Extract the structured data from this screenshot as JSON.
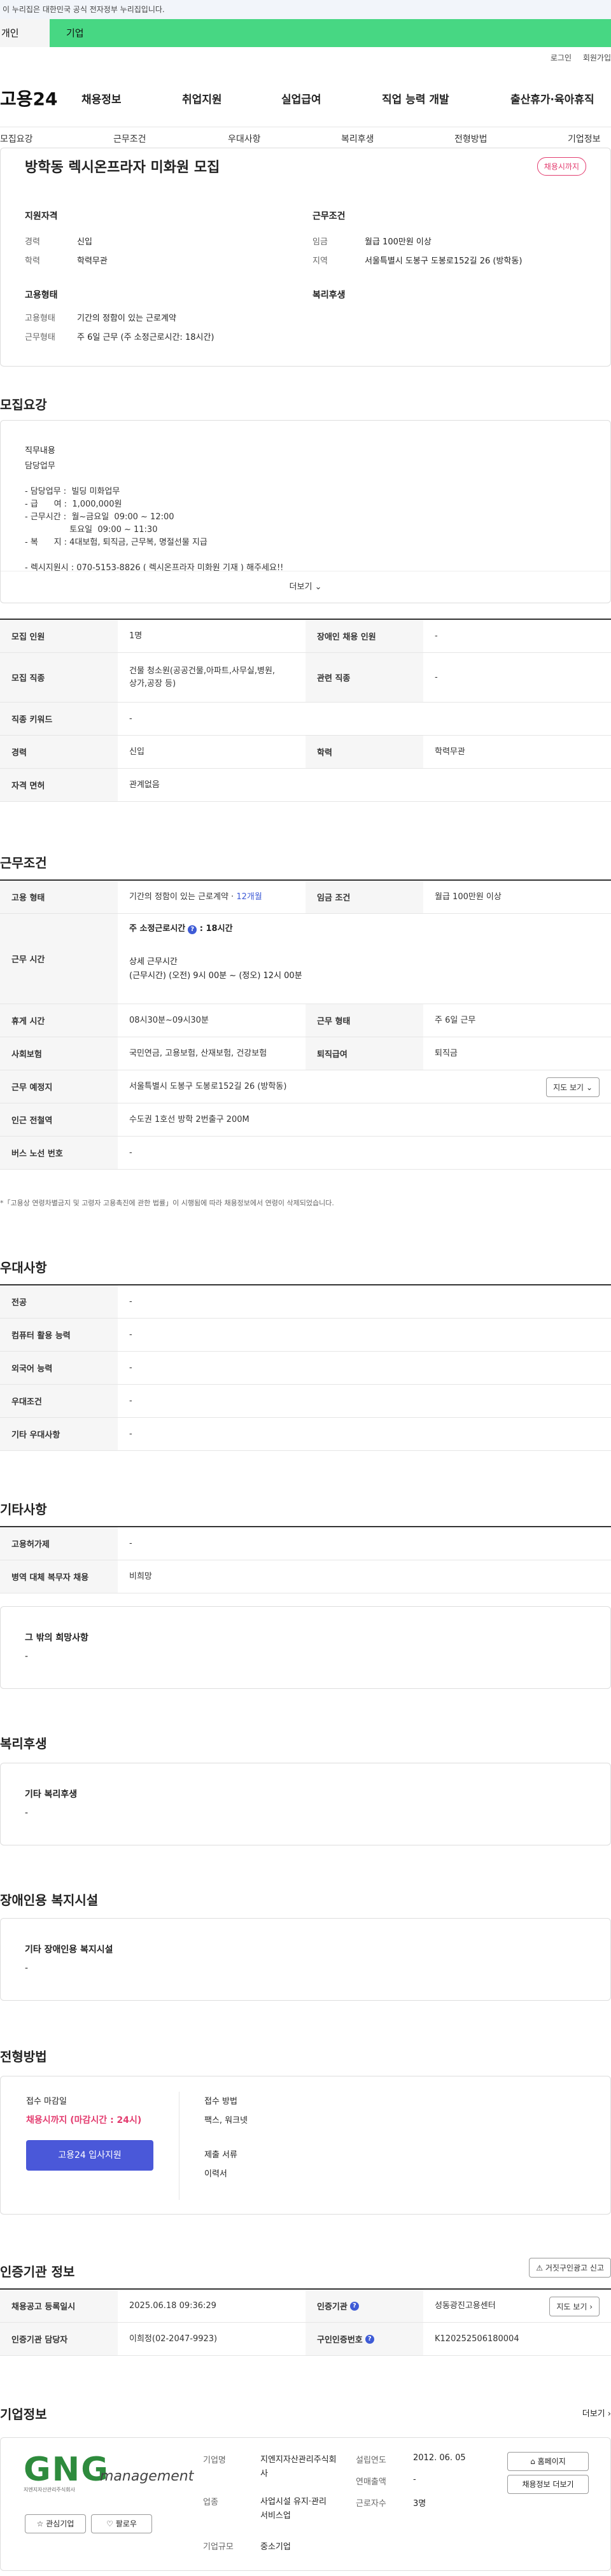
{
  "header": {
    "gov_notice": "이 누리집은 대한민국 공식 전자정부 누리집입니다.",
    "tab_individual": "개인",
    "tab_enterprise": "기업",
    "login": "로그인",
    "join": "회원가입",
    "logo": "고용24",
    "gnb": [
      "채용정보",
      "취업지원",
      "실업급여",
      "직업 능력 개발",
      "출산휴가·육아휴직"
    ]
  },
  "subnav": [
    "모집요강",
    "근무조건",
    "우대사항",
    "복리후생",
    "전형방법",
    "기업정보"
  ],
  "summary": {
    "title": "방학동 렉시온프라자 미화원 모집",
    "badge": "채용시까지",
    "qual_heading": "지원자격",
    "exp_label": "경력",
    "exp_value": "신입",
    "edu_label": "학력",
    "edu_value": "학력무관",
    "work_heading": "근무조건",
    "wage_label": "임금",
    "wage_value": "월급 100만원 이상",
    "region_label": "지역",
    "region_value": "서울특별시 도봉구 도봉로152길 26 (방학동)",
    "emp_heading": "고용형태",
    "emptype_label": "고용형태",
    "emptype_value": "기간의 정함이 있는 근로계약",
    "worktype_label": "근무형태",
    "worktype_value": "주 6일 근무 (주 소정근로시간: 18시간)",
    "welfare_heading": "복리후생"
  },
  "recruit": {
    "heading": "모집요강",
    "detail_title": "직무내용",
    "detail_text": "담당업무\n\n- 담당업무 :  빌딩 미화업무\n- 급      여 :  1,000,000원\n- 근무시간 :  월~금요일  09:00 ~ 12:00\n                 토요일  09:00 ~ 11:30\n- 복      지 : 4대보험, 퇴직금, 근무복, 명절선물 지급\n\n- 렉시지원시 : 070-5153-8826 ( 렉시온프라자 미화원 기재 ) 해주세요!!",
    "more": "더보기"
  },
  "recruit_table": {
    "headcount_label": "모집 인원",
    "headcount_value": "1명",
    "disabled_label": "장애인 채용 인원",
    "disabled_value": "-",
    "job_label": "모집 직종",
    "job_value": "건물 청소원(공공건물,아파트,사무실,병원,\n상가,공장 등)",
    "related_label": "관련 직종",
    "related_value": "-",
    "keyword_label": "직종 키워드",
    "keyword_value": "-",
    "exp_label": "경력",
    "exp_value": "신입",
    "edu_label": "학력",
    "edu_value": "학력무관",
    "license_label": "자격 면허",
    "license_value": "관계없음"
  },
  "conditions": {
    "heading": "근무조건",
    "emp_label": "고용 형태",
    "emp_value": "기간의 정함이 있는 근로계약",
    "emp_months": "12개월",
    "wage_label": "임금 조건",
    "wage_value": "월급 100만원 이상",
    "hours_label": "근무 시간",
    "hours_week": "주 소정근로시간",
    "hours_week_value": "18시간",
    "hours_detail_title": "상세 근무시간",
    "hours_detail": "(근무시간) (오전) 9시 00분 ~ (정오) 12시 00분",
    "break_label": "휴게 시간",
    "break_value": "08시30분~09시30분",
    "form_label": "근무 형태",
    "form_value": "주 6일 근무",
    "insurance_label": "사회보험",
    "insurance_value": "국민연금, 고용보험, 산재보험, 건강보험",
    "severance_label": "퇴직급여",
    "severance_value": "퇴직금",
    "place_label": "근무 예정지",
    "place_value": "서울특별시 도봉구 도봉로152길 26 (방학동)",
    "map_button": "지도 보기",
    "station_label": "인근 전철역",
    "station_value": "수도권 1호선 방학 2번출구 200M",
    "bus_label": "버스 노선 번호",
    "bus_value": "-",
    "note": "*「고용상 연령차별금지 및 고령자 고용촉진에 관한 법률」이 시행됨에 따라 채용정보에서 연령이 삭제되었습니다."
  },
  "preference": {
    "heading": "우대사항",
    "rows": [
      {
        "label": "전공",
        "value": "-"
      },
      {
        "label": "컴퓨터 활용 능력",
        "value": "-"
      },
      {
        "label": "외국어 능력",
        "value": "-"
      },
      {
        "label": "우대조건",
        "value": "-"
      },
      {
        "label": "기타 우대사항",
        "value": "-"
      }
    ]
  },
  "other": {
    "heading": "기타사항",
    "rows": [
      {
        "label": "고용허가제",
        "value": "-"
      },
      {
        "label": "병역 대체 복무자 채용",
        "value": "비희망"
      }
    ],
    "wish_title": "그 밖의 희망사항",
    "wish_value": "-"
  },
  "welfare": {
    "heading": "복리후생",
    "title": "기타 복리후생",
    "value": "-"
  },
  "facility": {
    "heading": "장애인용 복지시설",
    "title": "기타 장애인용 복지시설",
    "value": "-"
  },
  "selection": {
    "heading": "전형방법",
    "deadline_label": "접수 마감일",
    "deadline_value": "채용시까지 (마감시간 : 24시)",
    "apply_button": "고용24 입사지원",
    "method_label": "접수 방법",
    "method_value": "팩스, 워크넷",
    "docs_label": "제출 서류",
    "docs_value": "이력서"
  },
  "cert": {
    "heading": "인증기관 정보",
    "report_button": "거짓구인광고 신고",
    "reg_label": "채용공고 등록일시",
    "reg_value": "2025.06.18 09:36:29",
    "org_label": "인증기관",
    "org_value": "성동광진고용센터",
    "map_button": "지도 보기",
    "manager_label": "인증기관 담당자",
    "manager_value": "이희정(02-2047-9923)",
    "num_label": "구인인증번호",
    "num_value": "K120252506180004"
  },
  "company": {
    "heading": "기업정보",
    "more": "더보기",
    "logo_text": "GNG",
    "logo_sub": "management",
    "logo_caption": "지엔지자산관리주식회사",
    "interest_button": "관심기업",
    "follow_button": "팔로우",
    "type_label": "기업명",
    "type_value": "지엔지자산관리주식회사",
    "industry_label": "업종",
    "industry_value": "사업시설 유지·관리 서비스업",
    "scale_label": "기업규모",
    "scale_value": "중소기업",
    "founded_label": "설립연도",
    "founded_value": "2012. 06. 05",
    "sales_label": "연매출액",
    "sales_value": "-",
    "employees_label": "근로자수",
    "employees_value": "3명",
    "homepage_button": "홈페이지",
    "other_jobs_button": "채용정보 더보기"
  },
  "colors": {
    "brand_green": "#47d783",
    "apply_blue": "#4a58d9",
    "badge_red": "#e33c6f"
  }
}
